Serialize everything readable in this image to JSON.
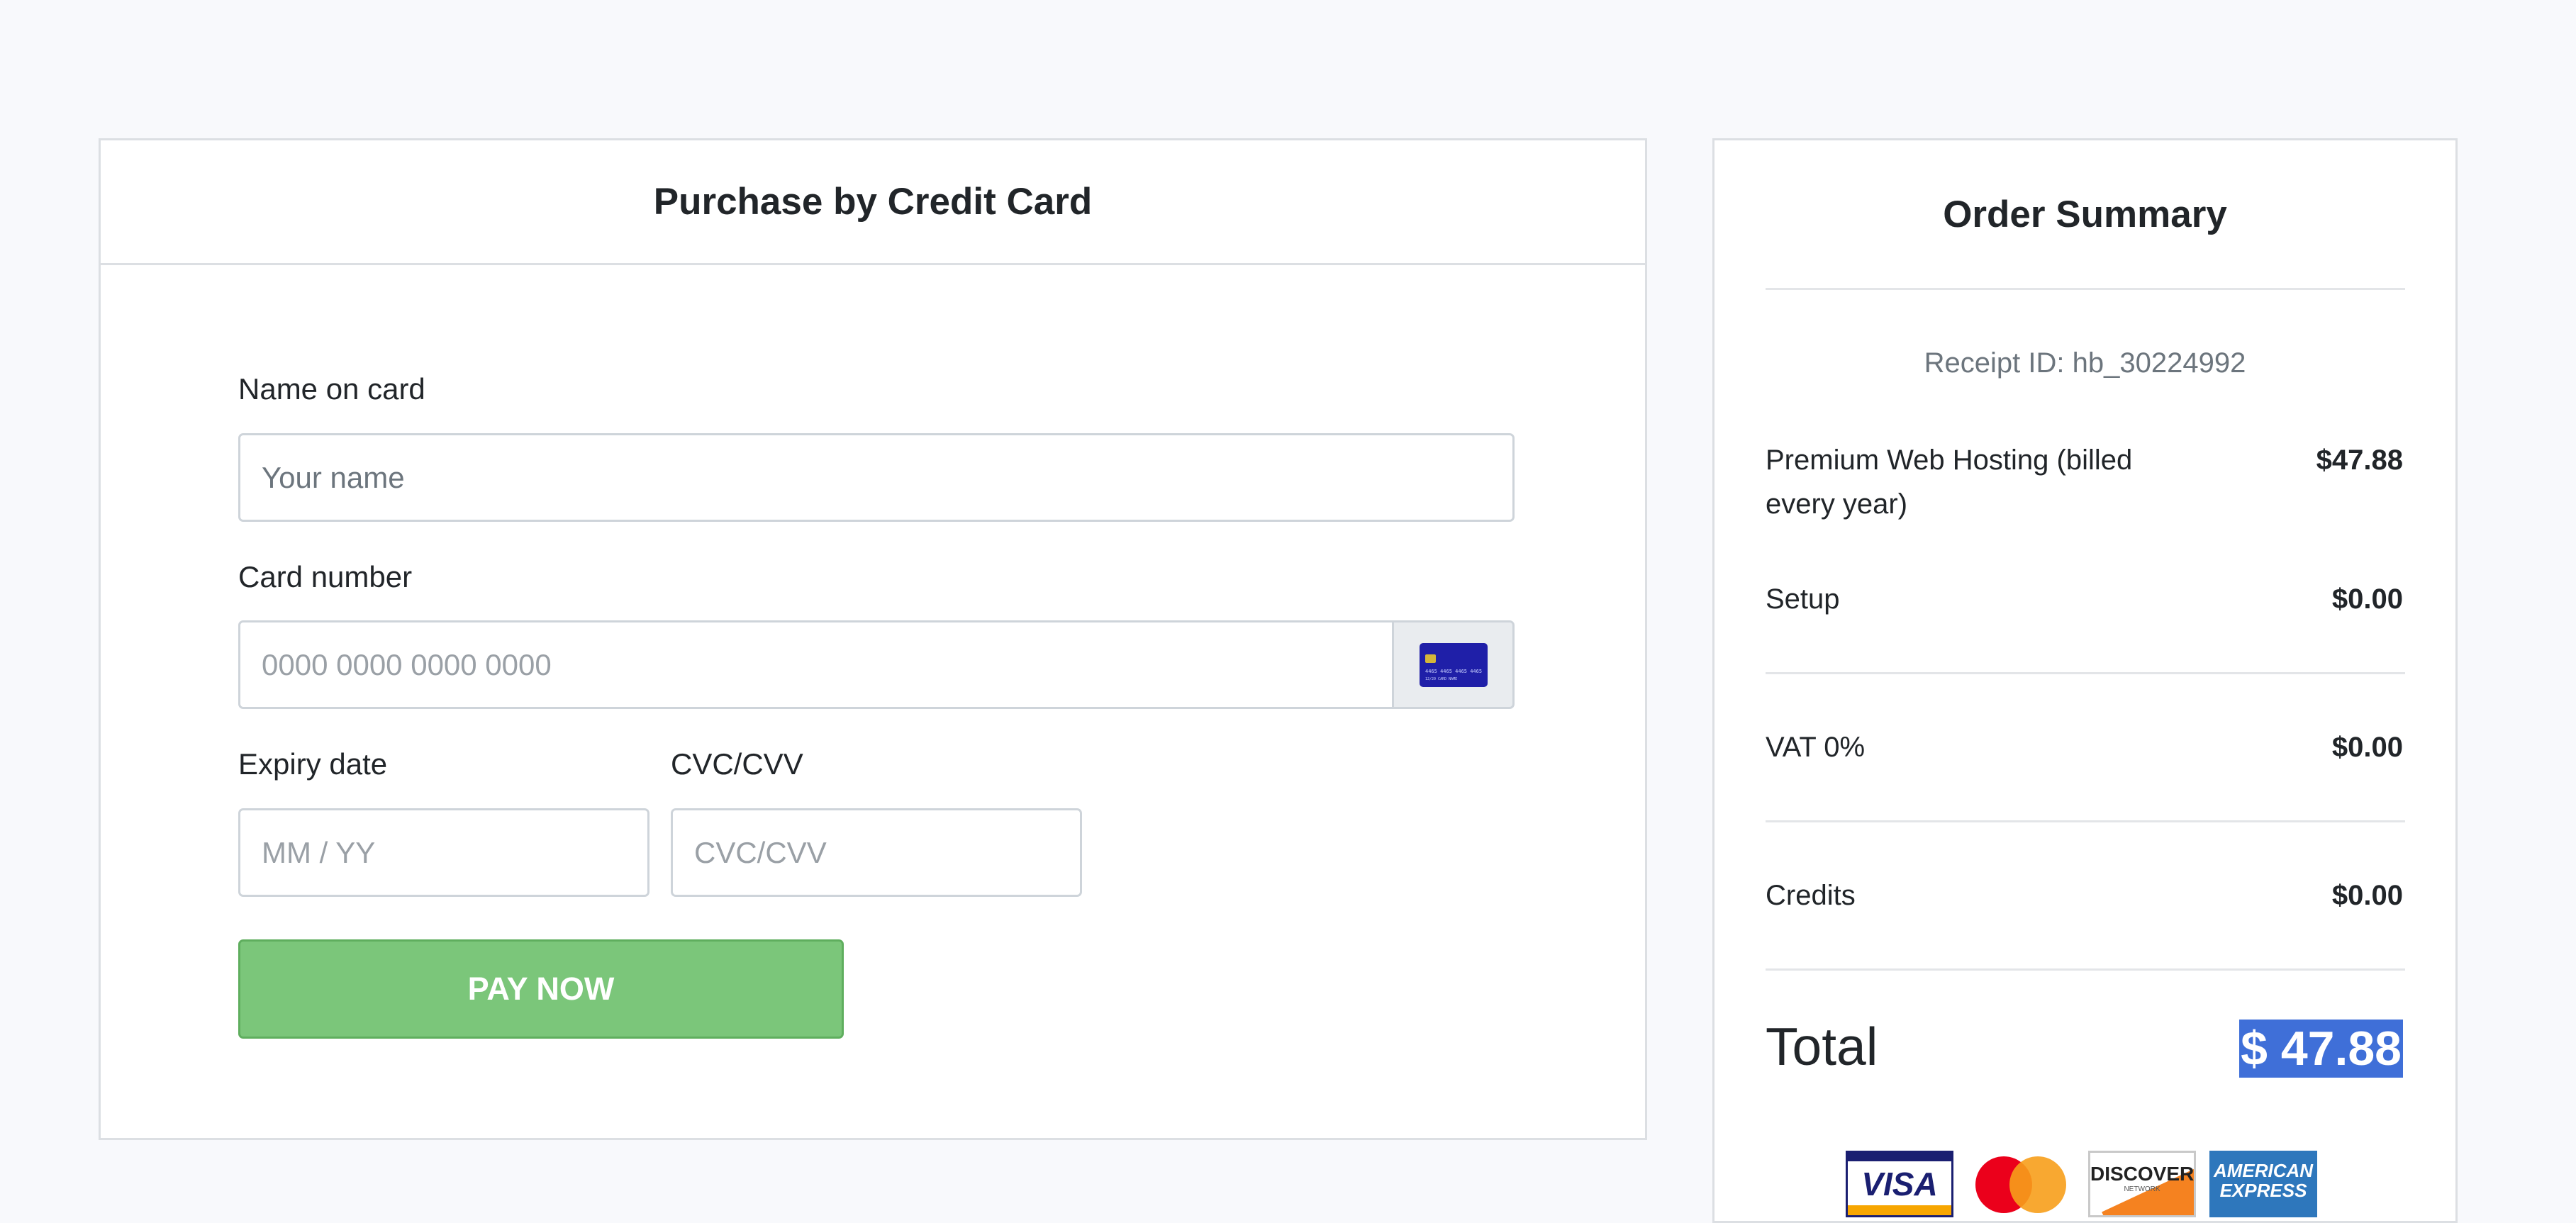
{
  "payment_form": {
    "title": "Purchase by Credit Card",
    "name_label": "Name on card",
    "name_placeholder": "Your name",
    "card_number_label": "Card number",
    "card_number_placeholder": "0000 0000 0000 0000",
    "card_icon": "credit-card-icon",
    "expiry_label": "Expiry date",
    "expiry_placeholder": "MM / YY",
    "cvc_label": "CVC/CVV",
    "cvc_placeholder": "CVC/CVV",
    "pay_button": "PAY NOW"
  },
  "order_summary": {
    "title": "Order Summary",
    "receipt": "Receipt ID: hb_30224992",
    "items": [
      {
        "label": "Premium Web Hosting (billed every year)",
        "value": "$47.88"
      },
      {
        "label": "Setup",
        "value": "$0.00"
      },
      {
        "label": "VAT 0%",
        "value": "$0.00"
      },
      {
        "label": "Credits",
        "value": "$0.00"
      }
    ],
    "total_label": "Total",
    "total_value": "$ 47.88",
    "card_logos": [
      {
        "name": "visa-logo",
        "text": "VISA"
      },
      {
        "name": "mastercard-logo",
        "text": ""
      },
      {
        "name": "discover-logo",
        "text": "DISCOVER",
        "sub": "NETWORK"
      },
      {
        "name": "amex-logo",
        "text": "AMERICAN EXPRESS"
      }
    ]
  },
  "colors": {
    "page_background": "#f8f9fc",
    "pay_button": "#7bc67a",
    "total_highlight": "#3f6fd8"
  }
}
